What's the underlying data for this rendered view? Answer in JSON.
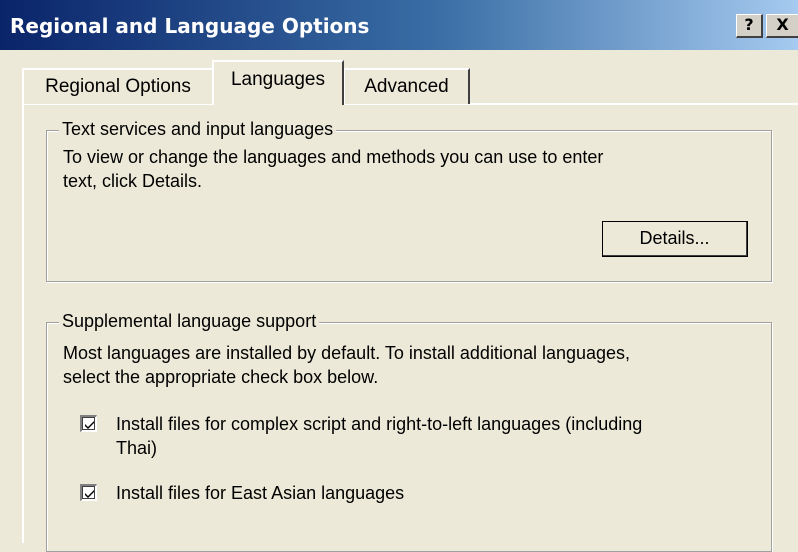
{
  "window": {
    "title": "Regional and Language Options",
    "help_button": "?",
    "close_button": "X"
  },
  "tabs": [
    {
      "label": "Regional Options",
      "selected": false
    },
    {
      "label": "Languages",
      "selected": true
    },
    {
      "label": "Advanced",
      "selected": false
    }
  ],
  "text_services": {
    "legend": "Text services and input languages",
    "description_line1": "To view or change the languages and methods you can use to enter",
    "description_line2": "text, click Details.",
    "details_button": "Details..."
  },
  "supplemental": {
    "legend": "Supplemental language support",
    "description_line1": "Most languages are installed by default. To install additional languages,",
    "description_line2": "select the appropriate check box below.",
    "options": [
      {
        "label_line1": "Install files for complex script and right-to-left languages (including",
        "label_line2": "Thai)",
        "checked": true
      },
      {
        "label_line1": "Install files for East Asian languages",
        "label_line2": "",
        "checked": true
      }
    ]
  },
  "colors": {
    "titlebar_start": "#0a246a",
    "titlebar_end": "#a6caf0",
    "face": "#ece9d8"
  },
  "icons": [
    "help-icon",
    "close-icon",
    "checkmark-icon"
  ]
}
